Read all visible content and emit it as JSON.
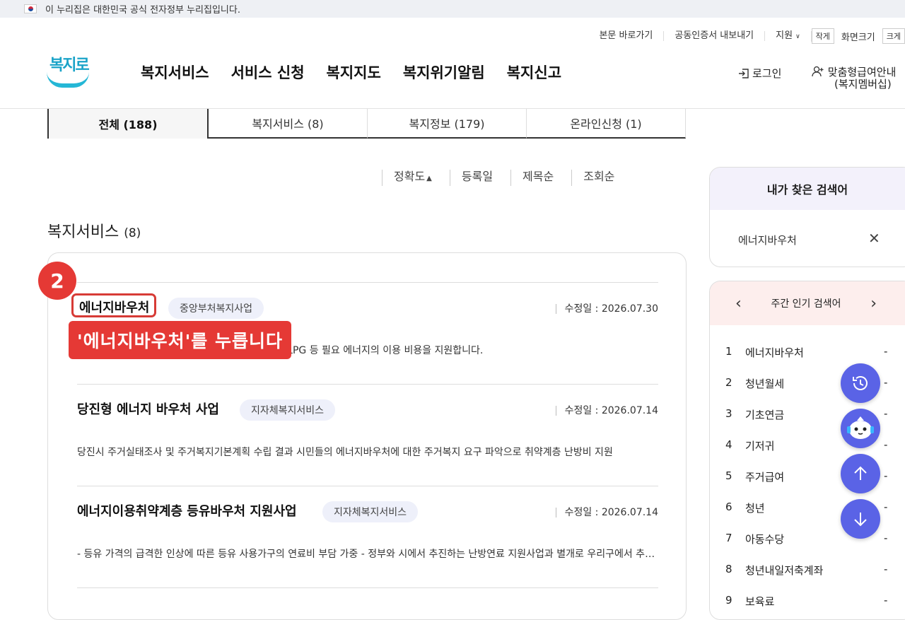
{
  "gov_banner": {
    "text": "이 누리집은 대한민국 공식 전자정부 누리집입니다."
  },
  "utility": {
    "skip": "본문 바로가기",
    "cert": "공동인증서 내보내기",
    "support": "지원",
    "small": "작게",
    "screen": "화면크기",
    "large": "크게"
  },
  "logo": {
    "text": "복지로"
  },
  "gnb": [
    "복지서비스",
    "서비스 신청",
    "복지지도",
    "복지위기알림",
    "복지신고"
  ],
  "header": {
    "login": "로그인",
    "member_line1": "맞춤형급여안내",
    "member_line2": "(복지멤버십)"
  },
  "tabs": [
    {
      "label": "전체  (188)",
      "active": true
    },
    {
      "label": "복지서비스 (8)",
      "active": false
    },
    {
      "label": "복지정보 (179)",
      "active": false
    },
    {
      "label": "온라인신청 (1)",
      "active": false
    }
  ],
  "sort": {
    "accuracy": "정확도",
    "date": "등록일",
    "title": "제목순",
    "views": "조회순"
  },
  "section": {
    "title": "복지서비스",
    "count": "(8)"
  },
  "results": [
    {
      "title": "에너지바우처",
      "tag": "중앙부처복지사업",
      "date": "수정일 : 2026.07.30",
      "desc": "에너지 취약계층에게 전기·도시가스·지역난방·등유·LPG 등 필요 에너지의 이용 비용을 지원합니다."
    },
    {
      "title": "당진형 에너지 바우처 사업",
      "tag": "지자체복지서비스",
      "date": "수정일 : 2026.07.14",
      "desc": "당진시 주거실태조사 및 주거복지기본계획 수립 결과 시민들의 에너지바우처에 대한 주거복지 요구 파악으로 취약계층 난방비 지원"
    },
    {
      "title": "에너지이용취약계층 등유바우처 지원사업",
      "tag": "지자체복지서비스",
      "date": "수정일 : 2026.07.14",
      "desc": "- 등유 가격의 급격한 인상에 따른 등유 사용가구의 연료비 부담 가중 - 정부와 시에서 추진하는 난방연료 지원사업과 별개로 우리구에서 추가 지원"
    }
  ],
  "annotation": {
    "step": "2",
    "callout": "'에너지바우처'를 누릅니다"
  },
  "my_search": {
    "title": "내가 찾은 검색어",
    "keyword": "에너지바우처"
  },
  "popular": {
    "title": "주간 인기 검색어",
    "items": [
      {
        "rank": "1",
        "word": "에너지바우처",
        "change": "-"
      },
      {
        "rank": "2",
        "word": "청년월세",
        "change": "-"
      },
      {
        "rank": "3",
        "word": "기초연금",
        "change": "-"
      },
      {
        "rank": "4",
        "word": "기저귀",
        "change": "-"
      },
      {
        "rank": "5",
        "word": "주거급여",
        "change": "-"
      },
      {
        "rank": "6",
        "word": "청년",
        "change": "-"
      },
      {
        "rank": "7",
        "word": "아동수당",
        "change": "-"
      },
      {
        "rank": "8",
        "word": "청년내일저축계좌",
        "change": "-"
      },
      {
        "rank": "9",
        "word": "보육료",
        "change": "-"
      }
    ]
  },
  "colors": {
    "accent": "#5a63e6",
    "highlight": "#e53935"
  }
}
